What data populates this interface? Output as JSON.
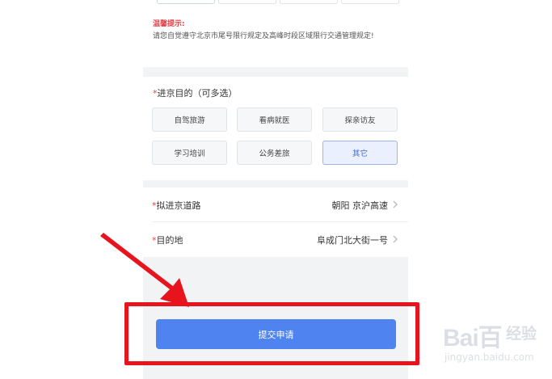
{
  "notice": {
    "title": "温馨提示:",
    "body": "请您自觉遵守北京市尾号限行规定及高峰时段区域限行交通管理规定!"
  },
  "purpose": {
    "required_mark": "*",
    "title": "进京目的（可多选）",
    "options": [
      {
        "label": "自驾旅游",
        "selected": false
      },
      {
        "label": "看病就医",
        "selected": false
      },
      {
        "label": "探亲访友",
        "selected": false
      },
      {
        "label": "学习培训",
        "selected": false
      },
      {
        "label": "公务差旅",
        "selected": false
      },
      {
        "label": "其它",
        "selected": true
      }
    ]
  },
  "route": {
    "required_mark": "*",
    "label": "拟进京道路",
    "value": "朝阳  京沪高速"
  },
  "destination": {
    "required_mark": "*",
    "label": "目的地",
    "value": "阜成门北大街一号"
  },
  "submit": {
    "label": "提交申请"
  },
  "watermark": {
    "logo": "Bai百",
    "brand": "经验",
    "url": "jingyan.baidu.com"
  },
  "colors": {
    "primary": "#4f84f0",
    "required": "#e0454c",
    "annotation": "#e8141d",
    "selected_chip_bg": "#eaf0fd"
  },
  "icons": {
    "row_chevron": "chevron-right-icon",
    "annotation_arrow": "arrow-icon"
  }
}
